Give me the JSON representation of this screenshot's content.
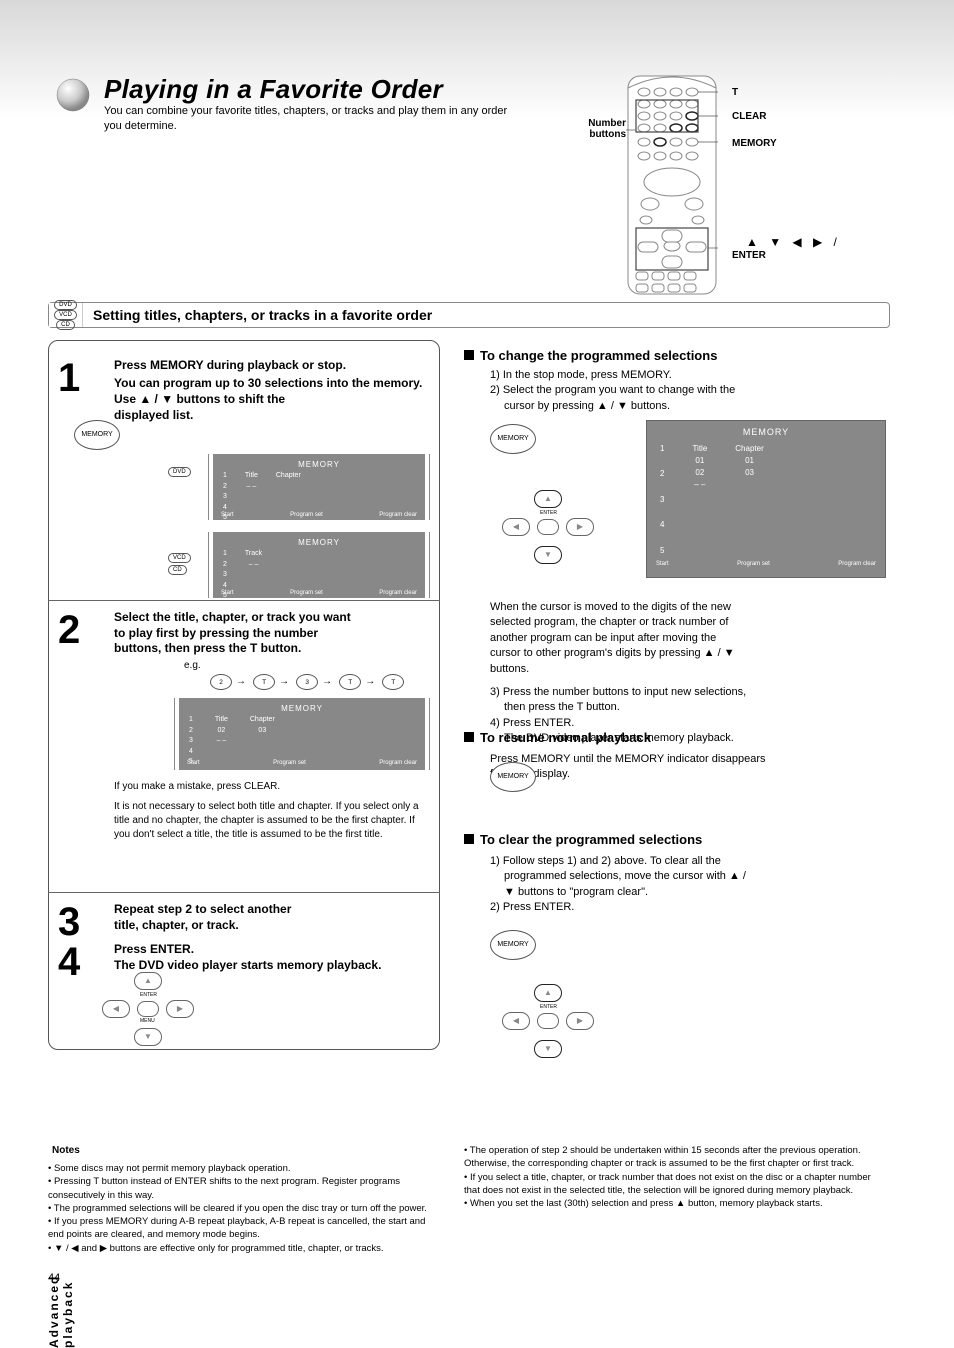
{
  "header": {
    "title": "Playing in a Favorite Order",
    "subtitle": "You can combine your favorite titles, chapters, or tracks and play them in any order you determine."
  },
  "remote_labels": {
    "t": "T",
    "clear": "CLEAR",
    "number": "Number buttons",
    "memory": "MEMORY",
    "cursor": "/    /    /    / ENTER"
  },
  "section_bar": {
    "icons": [
      "DVD",
      "VCD",
      "CD"
    ],
    "title": "Setting titles, chapters, or tracks in a favorite order"
  },
  "step1": {
    "num": "1",
    "title": "Press MEMORY during playback or stop.",
    "sub1": "You can program up to 30 selections into the memory.",
    "sub2": "Use     /     buttons to shift the",
    "sub3": "displayed list.",
    "btn": "MEMORY",
    "dvd_tag": "DVD",
    "vcd_tag": "VCD",
    "cd_tag": "CD",
    "screen_dvd": {
      "head": "MEMORY",
      "col_t": "Title",
      "col_c": "Chapter",
      "rows": [
        "1",
        "2",
        "3",
        "4",
        "5"
      ],
      "dash": "– –",
      "foot_l": "Start",
      "foot_m": "Program set",
      "foot_r": "Program clear"
    },
    "screen_cd": {
      "head": "MEMORY",
      "col_t": "Track",
      "rows": [
        "1",
        "2",
        "3",
        "4",
        "5"
      ],
      "dash": "– –",
      "foot_l": "Start",
      "foot_m": "Program set",
      "foot_r": "Program clear"
    }
  },
  "step2": {
    "num": "2",
    "title_a": "Select the title, chapter, or track you want",
    "title_b": "to play first by pressing the number",
    "title_c": "buttons, then press the T button.",
    "eg": "e.g.",
    "screen": {
      "head": "MEMORY",
      "col_t": "Title",
      "col_c": "Chapter",
      "rows": [
        "1",
        "2",
        "3",
        "4",
        "5"
      ],
      "v_t": "02",
      "v_c": "03",
      "dash": "– –",
      "foot_l": "Start",
      "foot_m": "Program set",
      "foot_r": "Program clear"
    },
    "btn_seq": [
      "2",
      "T",
      "3",
      "T",
      "T"
    ],
    "note1": "If you make a mistake, press CLEAR.",
    "note2": "It is not necessary to select both title and chapter. If you select only a title and no chapter, the chapter is assumed to be the first chapter. If you don't select a title, the title is assumed to be the first title."
  },
  "step3": {
    "num": "3",
    "title_a": "Repeat step 2 to select another",
    "title_b": "title, chapter, or track.",
    "labels": {
      "center": "ENTER"
    }
  },
  "step4": {
    "num": "4",
    "title": "Press ENTER.",
    "body": "The DVD video player starts memory playback.",
    "labels": {
      "center": "ENTER"
    }
  },
  "right": {
    "change": {
      "head": "To change the programmed selections",
      "l1": "1) In the stop mode, press MEMORY.",
      "l2": "2) Select the program you want to change with the",
      "l3": "cursor by pressing     /     buttons.",
      "l4": "3) Press the number buttons to input new selections,",
      "l5": "then press the T button.",
      "l6": "4) Press ENTER.",
      "l7": "The DVD video player starts memory playback.",
      "screen": {
        "head": "MEMORY",
        "col_t": "Title",
        "col_c": "Chapter",
        "rows": [
          "1",
          "2",
          "3",
          "4",
          "5"
        ],
        "v0t": "01",
        "v0c": "01",
        "v1t": "02",
        "v1c": "03",
        "dash": "– –",
        "foot_l": "Start",
        "foot_m": "Program set",
        "foot_r": "Program clear"
      },
      "btn": "MEMORY"
    },
    "resume": {
      "head": "To resume normal playback",
      "l1": "Press MEMORY until the MEMORY indicator disappears",
      "l2": "from the display.",
      "btn": "MEMORY"
    },
    "clear": {
      "head": "To clear the programmed selections",
      "l1": "1) Follow steps 1) and 2) above. To clear all the",
      "l2": "programmed selections, move the cursor with     /",
      "l3": "buttons to \"program clear\".",
      "l4": "2) Press ENTER.",
      "btn": "MEMORY"
    }
  },
  "vertlabel": "Advanced playback",
  "notes": {
    "title": "Notes",
    "items_left": [
      "• Some discs may not permit memory playback operation.",
      "• Pressing T button instead of ENTER shifts to the next program. Register programs consecutively in this way.",
      "• The programmed selections will be cleared if you open the disc tray or turn off the power.",
      "• If you press MEMORY during A-B repeat playback, A-B repeat is cancelled, the start and end points are cleared, and memory mode begins.",
      "•     /     and     buttons are effective only for programmed title, chapter, or tracks."
    ],
    "items_right": [
      "• The operation of step 2 should be undertaken within 15 seconds after the previous operation. Otherwise, the corresponding chapter or track is assumed to be the first chapter or first track.",
      "• If you select a title, chapter, or track number that does not exist on the disc or a chapter number that does not exist in the selected title, the selection will be ignored during memory playback.",
      "• When you set the last (30th) selection and press     button, memory playback starts."
    ]
  },
  "pagenum": "44"
}
